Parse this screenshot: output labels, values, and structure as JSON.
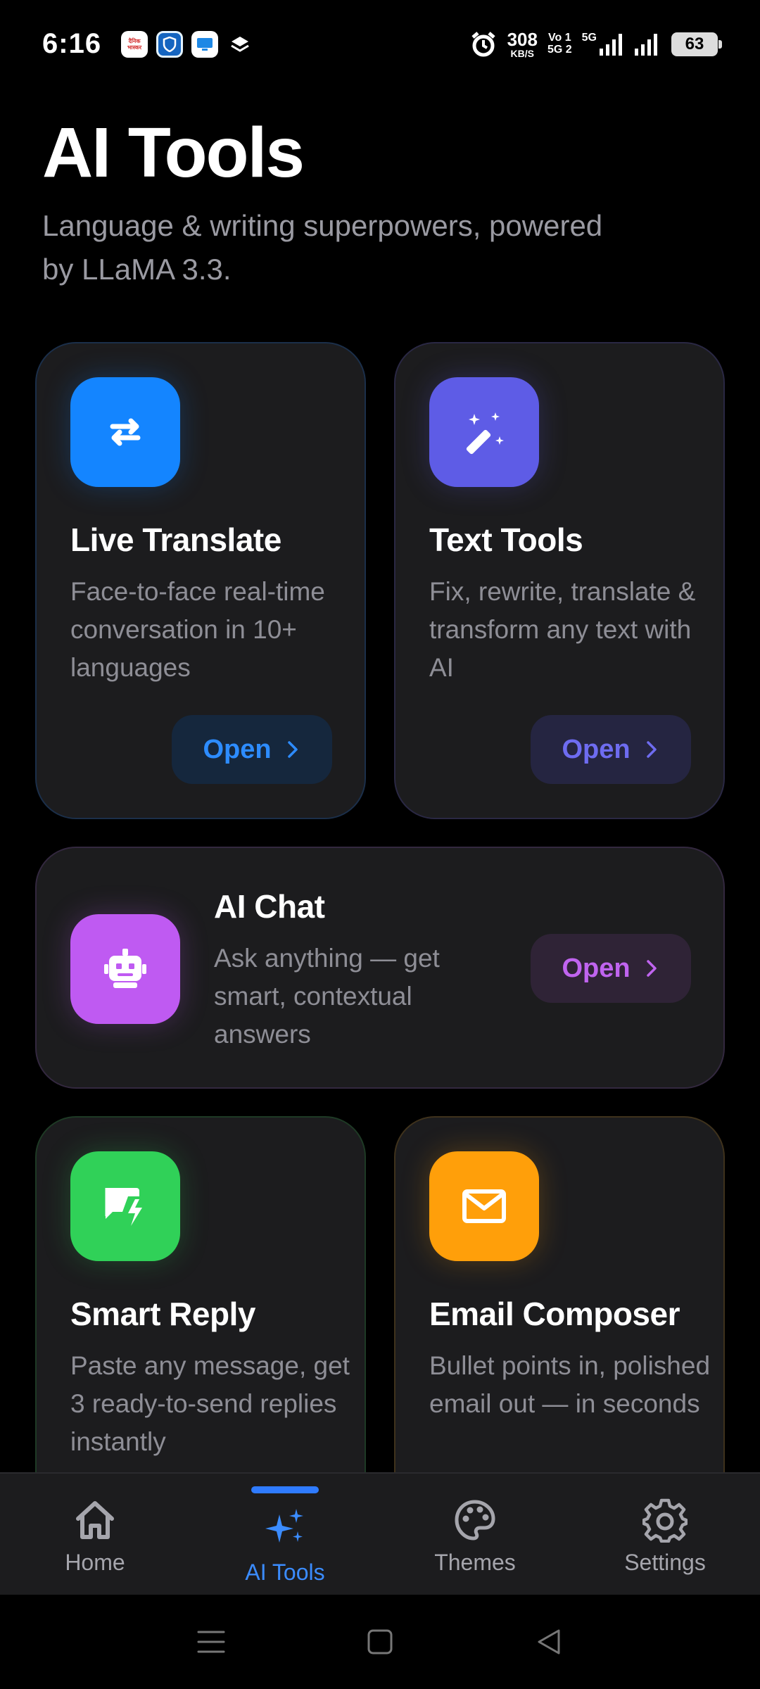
{
  "status_bar": {
    "time": "6:16",
    "app_badge_1": "दैनिक भास्कर",
    "net_speed_value": "308",
    "net_speed_unit": "KB/S",
    "volte_line1": "Vo 1",
    "volte_line2": "5G 2",
    "network_type": "5G",
    "battery": "63"
  },
  "header": {
    "title": "AI Tools",
    "subtitle": "Language & writing superpowers, powered by LLaMA 3.3."
  },
  "cards": {
    "live_translate": {
      "title": "Live Translate",
      "description": "Face-to-face real-time conversation in 10+ languages",
      "button": "Open",
      "icon": "arrows-swap-icon",
      "color": "#1485ff"
    },
    "text_tools": {
      "title": "Text Tools",
      "description": "Fix, rewrite, translate & transform any text with AI",
      "button": "Open",
      "icon": "magic-wand-icon",
      "color": "#5e5ce6"
    },
    "ai_chat": {
      "title": "AI Chat",
      "description": "Ask anything — get smart, contextual answers",
      "button": "Open",
      "icon": "robot-icon",
      "color": "#bf5af2"
    },
    "smart_reply": {
      "title": "Smart Reply",
      "description": "Paste any message, get 3 ready-to-send replies instantly",
      "icon": "chat-bolt-icon",
      "color": "#30d158"
    },
    "email_composer": {
      "title": "Email Composer",
      "description": "Bullet points in, polished email out — in seconds",
      "icon": "envelope-icon",
      "color": "#ff9f0a"
    }
  },
  "bottom_nav": {
    "items": [
      {
        "label": "Home",
        "icon": "home-icon",
        "active": false
      },
      {
        "label": "AI Tools",
        "icon": "sparkles-icon",
        "active": true
      },
      {
        "label": "Themes",
        "icon": "palette-icon",
        "active": false
      },
      {
        "label": "Settings",
        "icon": "gear-icon",
        "active": false
      }
    ],
    "accent": "#2f7bff"
  },
  "system_nav": {
    "icons": [
      "menu-icon",
      "home-square-icon",
      "back-triangle-icon"
    ]
  }
}
